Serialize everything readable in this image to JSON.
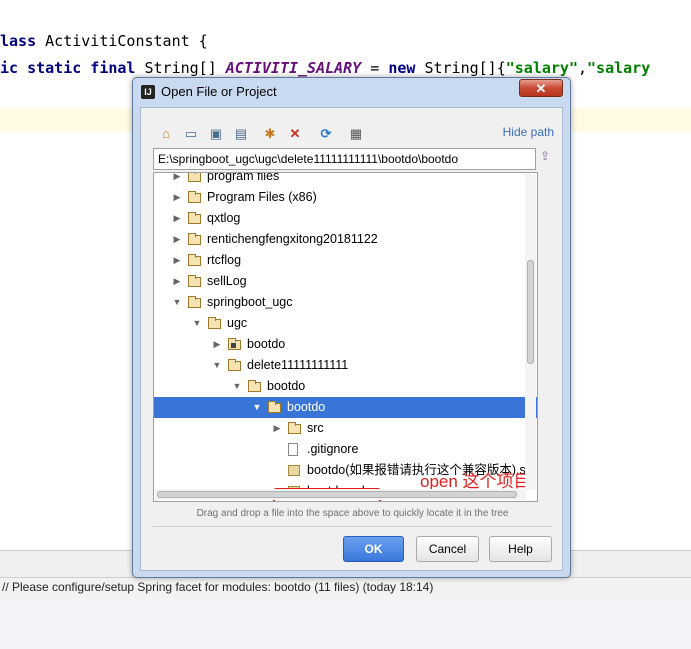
{
  "editor": {
    "line1_kw": "lass",
    "line1_name": " ActivitiConstant {",
    "line2_kw": "ic static final",
    "line2_type": " String[] ",
    "line2_const": "ACTIVITI_SALARY",
    "line2_eq": " = ",
    "line2_new": "new",
    "line2_type2": " String[]{",
    "line2_str1": "\"salary\"",
    "line2_comma": ",",
    "line2_str2": "\"salary"
  },
  "status_bar": {
    "text": "// Please configure/setup Spring facet for modules: bootdo (11 files) (today 18:14)"
  },
  "dialog": {
    "title": "Open File or Project",
    "app_icon": "IJ",
    "close": "✕",
    "hide_path": "Hide path",
    "path_value": "E:\\springboot_ugc\\ugc\\delete11111111111\\bootdo\\bootdo",
    "hint": "Drag and drop a file into the space above to quickly locate it in the tree",
    "ok": "OK",
    "cancel": "Cancel",
    "help": "Help"
  },
  "toolbar": {
    "home": "⌂",
    "desktop": "▭",
    "project": "▣",
    "module": "▤",
    "new_folder": "✱",
    "delete": "✕",
    "refresh": "⟳",
    "show_hidden": "▦",
    "path_go": "⇪"
  },
  "tree": {
    "items": [
      {
        "label": "program files",
        "level": 0,
        "arrow": "▶",
        "icon": "folder"
      },
      {
        "label": "Program Files (x86)",
        "level": 0,
        "arrow": "▶",
        "icon": "folder"
      },
      {
        "label": "qxtlog",
        "level": 0,
        "arrow": "▶",
        "icon": "folder"
      },
      {
        "label": "rentichengfengxitong20181122",
        "level": 0,
        "arrow": "▶",
        "icon": "folder"
      },
      {
        "label": "rtcflog",
        "level": 0,
        "arrow": "▶",
        "icon": "folder"
      },
      {
        "label": "sellLog",
        "level": 0,
        "arrow": "▶",
        "icon": "folder"
      },
      {
        "label": "springboot_ugc",
        "level": 0,
        "arrow": "▼",
        "icon": "folder"
      },
      {
        "label": "ugc",
        "level": 1,
        "arrow": "▼",
        "icon": "folder"
      },
      {
        "label": "bootdo",
        "level": 2,
        "arrow": "▶",
        "icon": "module"
      },
      {
        "label": "delete11111111111",
        "level": 2,
        "arrow": "▼",
        "icon": "folder"
      },
      {
        "label": "bootdo",
        "level": 3,
        "arrow": "▼",
        "icon": "folder"
      },
      {
        "label": "bootdo",
        "level": 4,
        "arrow": "▼",
        "icon": "folder",
        "selected": true
      },
      {
        "label": "src",
        "level": 5,
        "arrow": "▶",
        "icon": "folder"
      },
      {
        "label": ".gitignore",
        "level": 5,
        "arrow": "",
        "icon": "file"
      },
      {
        "label": "bootdo(如果报错请执行这个兼容版本).sq",
        "level": 5,
        "arrow": "",
        "icon": "sql"
      },
      {
        "label": "bootdo.sql",
        "level": 5,
        "arrow": "",
        "icon": "sql"
      }
    ]
  },
  "annotation": {
    "text": "open 这个项目"
  },
  "colors": {
    "selection": "#3875d7",
    "annotation": "#e02020",
    "ok_button": "#3a78dc"
  }
}
